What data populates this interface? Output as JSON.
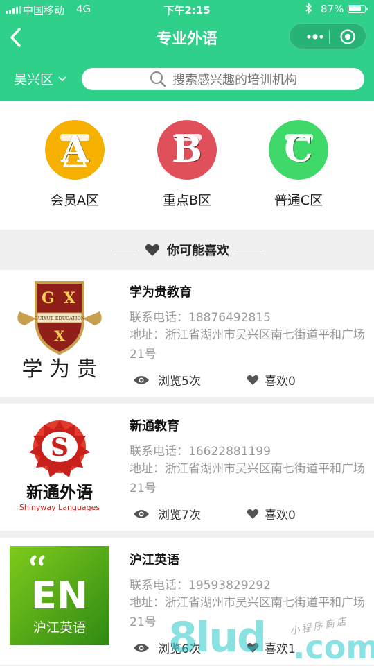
{
  "status_bar": {
    "carrier": "中国移动",
    "network": "4G",
    "time": "下午2:15",
    "battery_pct": "87%",
    "battery_level": 0.87
  },
  "nav": {
    "title": "专业外语"
  },
  "filter": {
    "district": "吴兴区",
    "search_placeholder": "搜索感兴趣的培训机构"
  },
  "categories": [
    {
      "letter": "A",
      "label": "会员A区",
      "color": "#f5b000"
    },
    {
      "letter": "B",
      "label": "重点B区",
      "color": "#e0505a"
    },
    {
      "letter": "C",
      "label": "普通C区",
      "color": "#3fd96a"
    }
  ],
  "section": {
    "title": "你可能喜欢"
  },
  "institutions": [
    {
      "name": "学为贵教育",
      "phone": "联系电话：18876492815",
      "address": "地址：浙江省湖州市吴兴区南七街道平和广场21号",
      "views": "浏览5次",
      "likes": "喜欢0",
      "logo": {
        "top_letters": "G",
        "top_letters_2": "X",
        "ribbon": "GUIXUE EDUCATION",
        "bottom_letter": "X",
        "bottom_text": "学 为 贵"
      }
    },
    {
      "name": "新通教育",
      "phone": "联系电话：16622881199",
      "address": "地址：浙江省湖州市吴兴区南七街道平和广场21号",
      "views": "浏览7次",
      "likes": "喜欢0",
      "logo": {
        "mark": "S",
        "cn": "新通外语",
        "en": "Shinyway Languages"
      }
    },
    {
      "name": "沪江英语",
      "phone": "联系电话：19593829292",
      "address": "地址：浙江省湖州市吴兴区南七街道平和广场21号",
      "views": "浏览6次",
      "likes": "喜欢1",
      "logo": {
        "mark": "EN",
        "cn": "沪江英语"
      }
    }
  ],
  "watermark": {
    "brand": "8lud",
    "tld": ".com",
    "tag": "小程序商店"
  },
  "colors": {
    "header_green": "#2ed08a",
    "bg": "#f0f0f0"
  }
}
